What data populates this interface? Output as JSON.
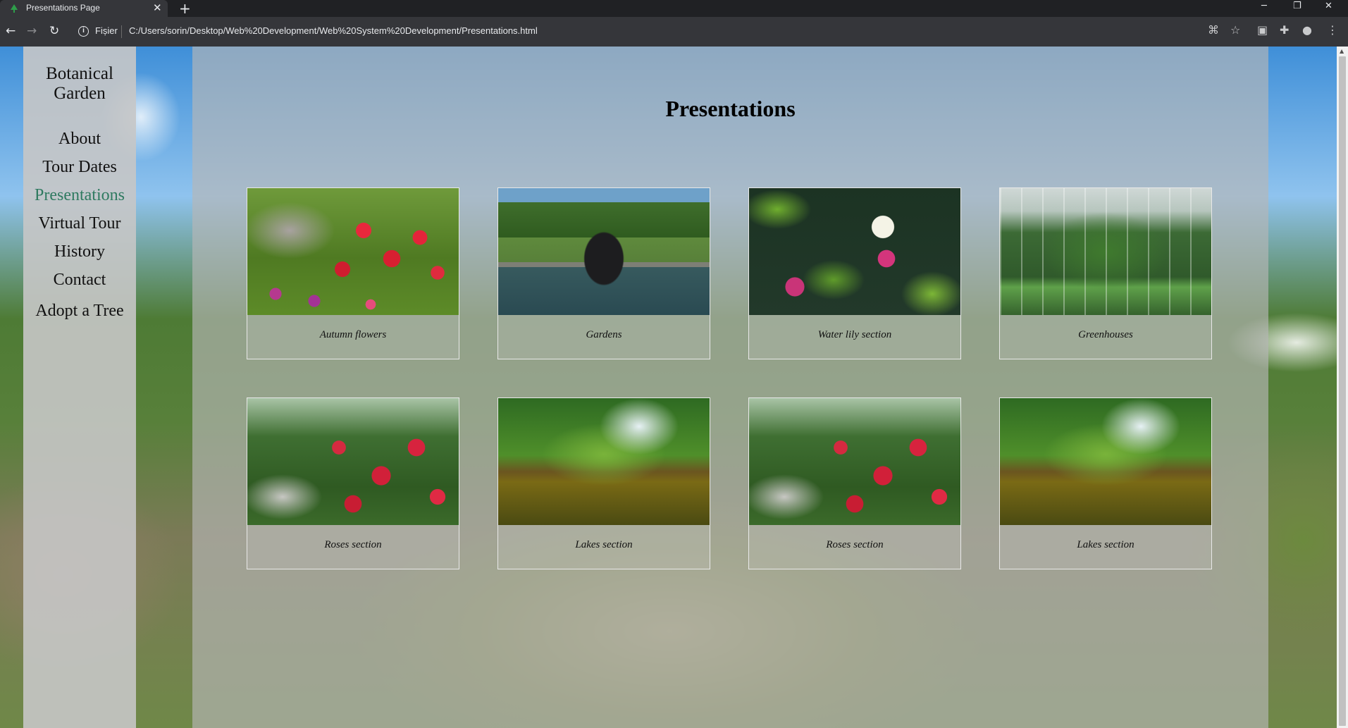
{
  "browser": {
    "tab": {
      "title": "Presentations Page"
    },
    "address_bar": {
      "scheme_label": "Fișier",
      "url": "C:/Users/sorin/Desktop/Web%20Development/Web%20System%20Development/Presentations.html"
    }
  },
  "sidebar": {
    "title_line1": "Botanical",
    "title_line2": "Garden",
    "items": [
      {
        "label": "About"
      },
      {
        "label": "Tour Dates"
      },
      {
        "label": "Presentations"
      },
      {
        "label": "Virtual Tour"
      },
      {
        "label": "History"
      },
      {
        "label": "Contact"
      }
    ],
    "active_item": "Presentations",
    "adopt_label": "Adopt a Tree"
  },
  "main": {
    "title": "Presentations",
    "cards": [
      {
        "caption": "Autumn flowers"
      },
      {
        "caption": "Gardens"
      },
      {
        "caption": "Water lily section"
      },
      {
        "caption": "Greenhouses"
      },
      {
        "caption": "Roses section"
      },
      {
        "caption": "Lakes section"
      },
      {
        "caption": "Roses section"
      },
      {
        "caption": "Lakes section"
      }
    ]
  },
  "colors": {
    "active_menu": "#2f7a60",
    "sidebar_bg": "#c7c7c7",
    "browser_frame": "#202124"
  }
}
